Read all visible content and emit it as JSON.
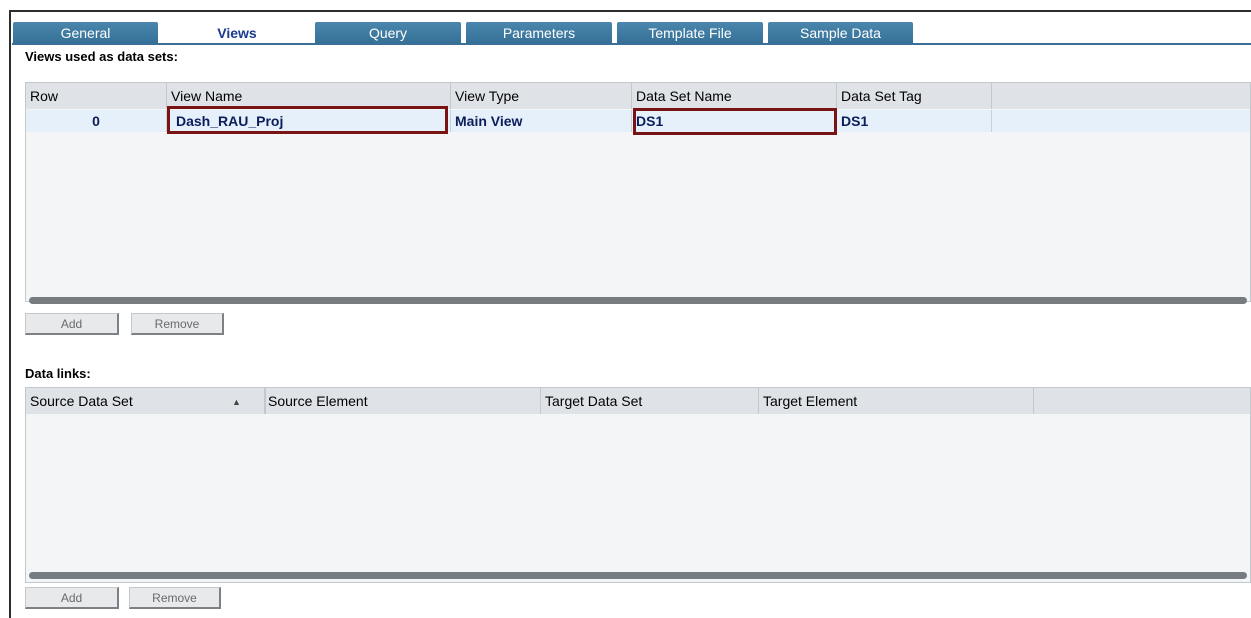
{
  "tabs": [
    {
      "label": "General",
      "active": false
    },
    {
      "label": "Views",
      "active": true
    },
    {
      "label": "Query",
      "active": false
    },
    {
      "label": "Parameters",
      "active": false
    },
    {
      "label": "Template File",
      "active": false
    },
    {
      "label": "Sample Data",
      "active": false
    }
  ],
  "views_section": {
    "title": "Views used as data sets:",
    "columns": [
      "Row",
      "View Name",
      "View Type",
      "Data Set Name",
      "Data Set Tag"
    ],
    "rows": [
      {
        "row": "0",
        "view_name": "Dash_RAU_Proj",
        "view_type": "Main View",
        "data_set_name": "DS1",
        "data_set_tag": "DS1"
      }
    ],
    "add_label": "Add",
    "remove_label": "Remove"
  },
  "links_section": {
    "title": "Data links:",
    "columns": [
      "Source Data Set",
      "Source Element",
      "Target Data Set",
      "Target Element"
    ],
    "sort_icon": "sort-ascending-icon",
    "add_label": "Add",
    "remove_label": "Remove"
  },
  "colors": {
    "tab_bg": "#3f7aa1",
    "highlight": "#7a1313",
    "row_text": "#0b1d5a"
  }
}
